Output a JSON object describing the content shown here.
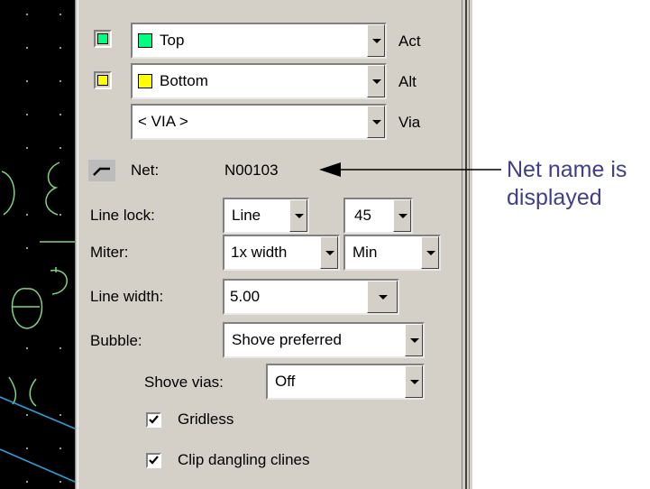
{
  "layers": [
    {
      "name": "Top",
      "role": "Act",
      "color": "#00ff80"
    },
    {
      "name": "Bottom",
      "role": "Alt",
      "color": "#ffff00"
    }
  ],
  "via": {
    "value": "< VIA >",
    "role": "Via"
  },
  "net": {
    "label": "Net:",
    "value": "N00103"
  },
  "line_lock": {
    "label": "Line lock:",
    "mode": "Line",
    "angle": "45"
  },
  "miter": {
    "label": "Miter:",
    "size": "1x width",
    "mode": "Min"
  },
  "line_width": {
    "label": "Line width:",
    "value": "5.00"
  },
  "bubble": {
    "label": "Bubble:",
    "value": "Shove preferred"
  },
  "shove_vias": {
    "label": "Shove vias:",
    "value": "Off"
  },
  "gridless": {
    "label": "Gridless",
    "checked": true
  },
  "clip_dangling": {
    "label": "Clip dangling clines",
    "checked": true
  },
  "annotation": {
    "line1": "Net name is",
    "line2": "displayed",
    "color": "#3f3f8c"
  }
}
